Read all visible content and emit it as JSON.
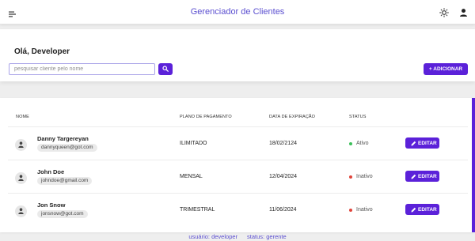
{
  "header": {
    "title": "Gerenciador de Clientes",
    "menu_icon": "hamburger-icon",
    "theme_icon": "sun-icon",
    "user_icon": "user-icon"
  },
  "welcome": {
    "greeting": "Olá, Developer",
    "search_placeholder": "pesquisar cliente pelo nome",
    "search_value": "",
    "search_icon": "search-icon",
    "add_label": "+ ADICIONAR"
  },
  "table": {
    "columns": [
      "NOME",
      "PLANO DE PAGAMENTO",
      "DATA DE EXPIRAÇÃO",
      "STATUS"
    ],
    "rows": [
      {
        "name": "Danny Targereyan",
        "email": "dannyqueen@got.com",
        "plan": "ILIMITADO",
        "expiration": "18/02/2124",
        "status": "Ativo",
        "status_color": "#3cc05a",
        "edit_label": "EDITAR"
      },
      {
        "name": "John Doe",
        "email": "johndoe@gmail.com",
        "plan": "MENSAL",
        "expiration": "12/04/2024",
        "status": "Inativo",
        "status_color": "#e0443a",
        "edit_label": "EDITAR"
      },
      {
        "name": "Jon Snow",
        "email": "jonsnow@got.com",
        "plan": "TRIMESTRAL",
        "expiration": "11/06/2024",
        "status": "Inativo",
        "status_color": "#e0443a",
        "edit_label": "EDITAR"
      }
    ]
  },
  "footer": {
    "user_text": "usuário: developer",
    "status_text": "status: gerente"
  },
  "colors": {
    "accent": "#5b21d9",
    "title": "#5b4fd0",
    "active": "#3cc05a",
    "inactive": "#e0443a"
  }
}
